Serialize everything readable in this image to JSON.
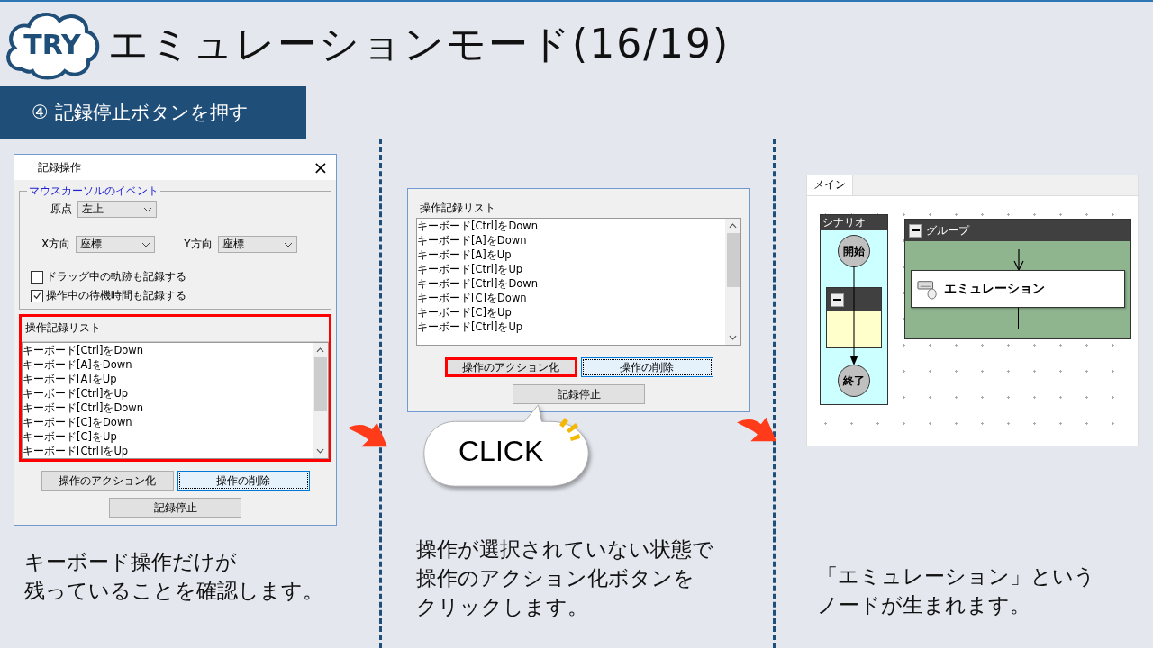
{
  "header": {
    "badge": "TRY",
    "title": "エミュレーションモード(16/19)"
  },
  "step": "④ 記録停止ボタンを押す",
  "dialog": {
    "title": "記録操作",
    "close": "×",
    "group_label": "マウスカーソルのイベント",
    "origin": {
      "label": "原点",
      "value": "左上"
    },
    "x_direction": {
      "label": "X方向",
      "value": "座標"
    },
    "y_direction": {
      "label": "Y方向",
      "value": "座標"
    },
    "checkboxes": [
      {
        "label": "ドラッグ中の軌跡も記録する",
        "checked": false
      },
      {
        "label": "操作中の待機時間も記録する",
        "checked": true
      }
    ],
    "list_label": "操作記録リスト",
    "list_highlighted": true,
    "list_items": [
      "キーボード[Ctrl]をDown",
      "キーボード[A]をDown",
      "キーボード[A]をUp",
      "キーボード[Ctrl]をUp",
      "キーボード[Ctrl]をDown",
      "キーボード[C]をDown",
      "キーボード[C]をUp",
      "キーボード[Ctrl]をUp"
    ],
    "buttons": [
      {
        "label": "操作のアクション化",
        "focused": false,
        "highlighted": false
      },
      {
        "label": "操作の削除",
        "focused": true,
        "highlighted": false
      }
    ],
    "stop_button": "記録停止"
  },
  "dialog_detail": {
    "list_label": "操作記録リスト",
    "list_highlighted": false,
    "list_items": [
      "キーボード[Ctrl]をDown",
      "キーボード[A]をDown",
      "キーボード[A]をUp",
      "キーボード[Ctrl]をUp",
      "キーボード[Ctrl]をDown",
      "キーボード[C]をDown",
      "キーボード[C]をUp",
      "キーボード[Ctrl]をUp"
    ],
    "buttons": [
      {
        "label": "操作のアクション化",
        "focused": false,
        "highlighted": true
      },
      {
        "label": "操作の削除",
        "focused": true,
        "highlighted": false
      }
    ],
    "stop_button": "記録停止",
    "callout": "CLICK"
  },
  "flow": {
    "tab": "メイン",
    "scenario": {
      "title": "シナリオ",
      "start": "開始",
      "end": "終了"
    },
    "group": {
      "title": "グループ",
      "node": "エミュレーション"
    }
  },
  "captions": [
    [
      "キーボード操作だけが",
      "残っていることを確認します。"
    ],
    [
      "操作が選択されていない状態で",
      "操作のアクション化ボタンを",
      "クリックします。"
    ],
    [
      "「エミュレーション」という",
      "ノードが生まれます。"
    ]
  ]
}
